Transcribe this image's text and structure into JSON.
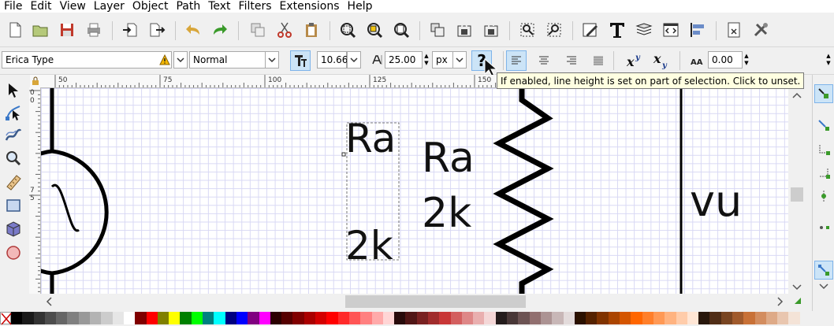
{
  "menu": [
    "File",
    "Edit",
    "View",
    "Layer",
    "Object",
    "Path",
    "Text",
    "Filters",
    "Extensions",
    "Help"
  ],
  "toolbar_icons": [
    "new-document-icon",
    "open-icon",
    "save-icon",
    "print-icon",
    "import-icon",
    "export-icon",
    "undo-icon",
    "redo-icon",
    "duplicate-icon",
    "cut-icon",
    "paste-icon",
    "zoom-selection-icon",
    "zoom-drawing-icon",
    "zoom-page-icon",
    "group-icon",
    "lock-icon",
    "unlock-icon",
    "align-node-icon",
    "align-object-icon",
    "pen-edit-icon",
    "text-tool-icon",
    "layers-icon",
    "xml-editor-icon",
    "align-distribute-icon",
    "document-properties-icon",
    "preferences-icon"
  ],
  "text_controls": {
    "font_family": "Erica Type",
    "font_style": "Normal",
    "font_size": "10.66",
    "line_height": "25.00",
    "unit": "px",
    "letter_spacing": "0.00",
    "question_mark": "?"
  },
  "tooltip": "If enabled, line height is set on part of selection. Click to unset.",
  "ruler": {
    "h_labels": [
      "50",
      "75",
      "100",
      "125",
      "150"
    ],
    "v_labels": [
      "0",
      "0",
      "7",
      "5"
    ]
  },
  "canvas": {
    "texts": {
      "ra_1": "Ra",
      "k2_1": "2k",
      "ra_2": "Ra",
      "k2_2": "2k",
      "vu": "vu"
    }
  },
  "palette": [
    "#000000",
    "#1a1a1a",
    "#333333",
    "#4d4d4d",
    "#666666",
    "#808080",
    "#999999",
    "#b3b3b3",
    "#cccccc",
    "#e6e6e6",
    "#ffffff",
    "#800000",
    "#ff0000",
    "#808000",
    "#ffff00",
    "#008000",
    "#00ff00",
    "#008080",
    "#00ffff",
    "#000080",
    "#0000ff",
    "#800080",
    "#ff00ff",
    "#2b0000",
    "#550000",
    "#800000",
    "#aa0000",
    "#d40000",
    "#ff0000",
    "#ff2a2a",
    "#ff5555",
    "#ff8080",
    "#ffaaaa",
    "#ffd5d5",
    "#280b0b",
    "#501616",
    "#782121",
    "#a02c2c",
    "#c83737",
    "#d35f5f",
    "#de8787",
    "#e9afaf",
    "#f4d7d7",
    "#241c1c",
    "#483737",
    "#6c5353",
    "#916f6f",
    "#ac9393",
    "#c8b7b7",
    "#e3dbdb",
    "#2b1100",
    "#552200",
    "#803300",
    "#aa4400",
    "#d45500",
    "#ff6600",
    "#ff7f2a",
    "#ff9955",
    "#ffb380",
    "#ffccaa",
    "#ffe6d5",
    "#28170b",
    "#502d16",
    "#784421",
    "#a05a2c",
    "#c87137",
    "#d38d5f",
    "#deaa87",
    "#e9c6af",
    "#f4e3d7"
  ]
}
